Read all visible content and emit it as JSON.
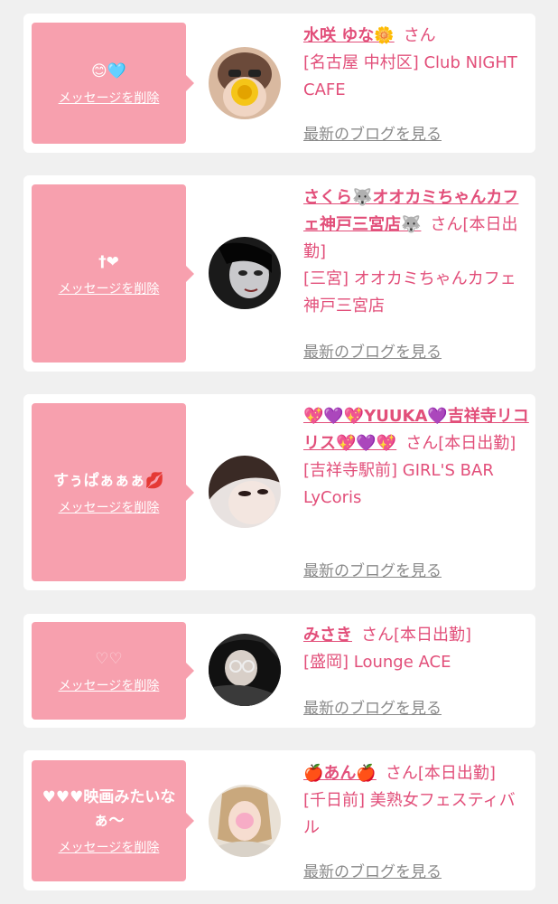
{
  "cards": [
    {
      "message": "😊🩵",
      "delete_label": "メッセージを削除",
      "name": "水咲 ゆな🌼",
      "honorific": "さん",
      "status": "",
      "location": "[名古屋 中村区] Club NIGHT CAFE",
      "blog_label": "最新のブログを見る"
    },
    {
      "message": "†❤",
      "delete_label": "メッセージを削除",
      "name": "さくら🐺オオカミちゃんカフェ神戸三宮店🐺",
      "honorific": "さん",
      "status": "[本日出勤]",
      "location": "[三宮] オオカミちゃんカフェ神戸三宮店",
      "blog_label": "最新のブログを見る"
    },
    {
      "message": "すぅぱぁぁぁ💋",
      "delete_label": "メッセージを削除",
      "name": "💖💜💖YUUKA💜吉祥寺リコリス💖💜💖",
      "honorific": "さん",
      "status": "[本日出勤]",
      "location": "[吉祥寺駅前] GIRL'S BAR LyCoris",
      "blog_label": "最新のブログを見る"
    },
    {
      "message": "♡♡",
      "delete_label": "メッセージを削除",
      "name": "みさき",
      "honorific": "さん",
      "status": "[本日出勤]",
      "location": "[盛岡] Lounge ACE",
      "blog_label": "最新のブログを見る"
    },
    {
      "message": "♥♥♥映画みたいなぁ〜",
      "delete_label": "メッセージを削除",
      "name": "🍎あん🍎",
      "honorific": "さん",
      "status": "[本日出勤]",
      "location": "[千日前] 美熟女フェスティバル",
      "blog_label": "最新のブログを見る"
    }
  ],
  "colors": {
    "accent": "#e24f7a",
    "bubble": "#f7a0ae",
    "background": "#f0f0f0",
    "link_gray": "#8a8a8a"
  },
  "icons": {
    "avatar": "user-photo"
  }
}
